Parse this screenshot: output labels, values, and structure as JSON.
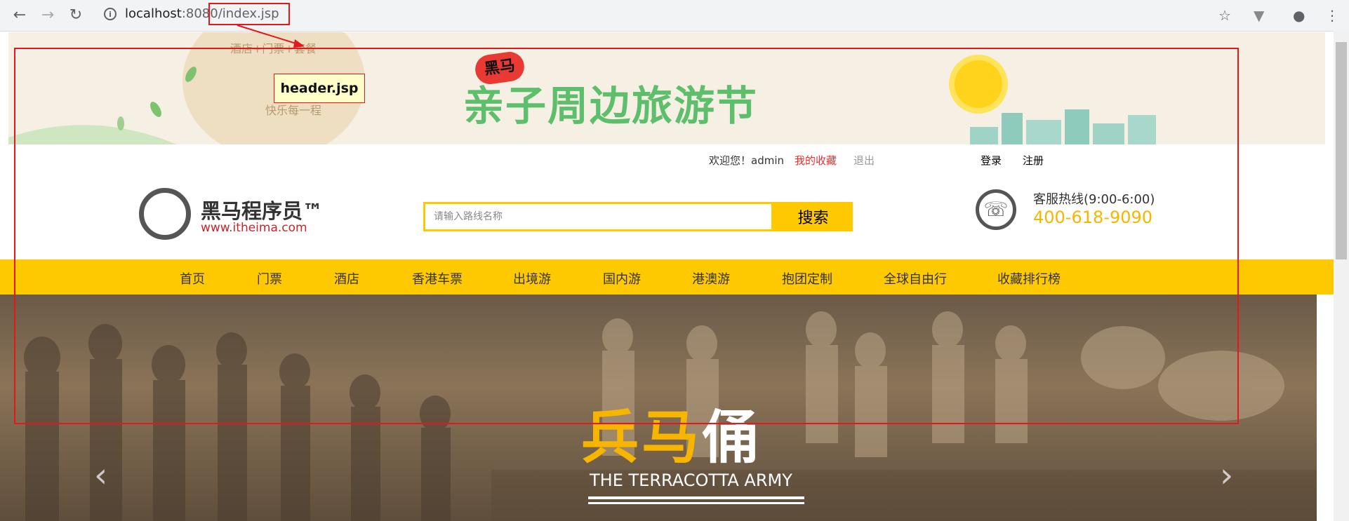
{
  "browser": {
    "url_host": "localhost",
    "url_port": ":8080",
    "url_path": "/index.jsp"
  },
  "annotation": {
    "label": "header.jsp",
    "color": "#e8151b"
  },
  "banner": {
    "brand": "黑马",
    "title": "亲子周边旅游节",
    "side_text_1": "酒店+门票+套餐",
    "side_text_2": "快乐每一程"
  },
  "header": {
    "welcome": "欢迎您！admin",
    "favorites": "我的收藏",
    "logout": "退出",
    "login": "登录",
    "register": "注册",
    "logo_cn": "黑马程序员™",
    "logo_en": "www.itheima.com",
    "search_placeholder": "请输入路线名称",
    "search_button": "搜索",
    "hotline_label": "客服热线(9:00-6:00)",
    "hotline_number": "400-618-9090",
    "accent_color": "#ffc900"
  },
  "nav": {
    "items": [
      "首页",
      "门票",
      "酒店",
      "香港车票",
      "出境游",
      "国内游",
      "港澳游",
      "抱团定制",
      "全球自由行",
      "收藏排行榜"
    ]
  },
  "hero": {
    "title_part1": "兵马",
    "title_part2": "俑",
    "subtitle": "THE TERRACOTTA ARMY",
    "prev_icon": "chevron-left-icon",
    "next_icon": "chevron-right-icon"
  }
}
